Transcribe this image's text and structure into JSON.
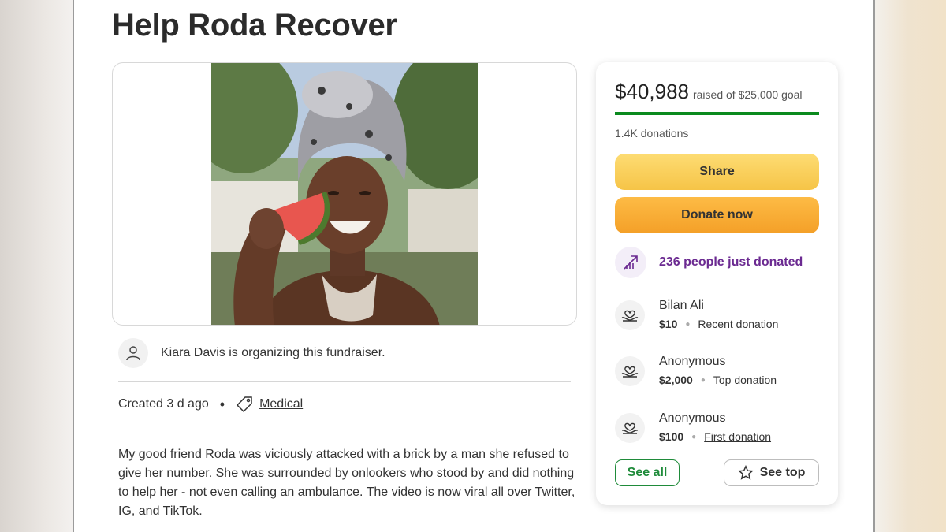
{
  "campaign": {
    "title": "Help Roda Recover"
  },
  "organizer": {
    "text": "Kiara Davis is organizing this fundraiser."
  },
  "meta": {
    "created": "Created 3 d ago",
    "category": "Medical"
  },
  "story": "My good friend Roda was viciously attacked with a brick by a man she refused to give her number. She was surrounded by onlookers who stood by and did nothing to help her - not even calling an ambulance. The video is now viral all over Twitter, IG, and TikTok.",
  "donation_card": {
    "raised": "$40,988",
    "goal_text": "raised of $25,000 goal",
    "progress_fraction": 1.0,
    "donation_count": "1.4K donations",
    "share_label": "Share",
    "donate_label": "Donate now",
    "trend_text": "236 people just donated",
    "donors": [
      {
        "name": "Bilan Ali",
        "amount": "$10",
        "kind": "Recent donation"
      },
      {
        "name": "Anonymous",
        "amount": "$2,000",
        "kind": "Top donation"
      },
      {
        "name": "Anonymous",
        "amount": "$100",
        "kind": "First donation"
      }
    ],
    "see_all_label": "See all",
    "see_top_label": "See top"
  },
  "colors": {
    "progress": "#0b8a1e",
    "trend": "#6b2a91",
    "share": "#f8cb54",
    "donate": "#f7a934",
    "see_all": "#1f8b3a"
  },
  "icons": {
    "organizer": "person-icon",
    "category": "tag-icon",
    "trend": "trending-up-icon",
    "donor": "heart-hands-icon",
    "see_top": "star-icon"
  }
}
